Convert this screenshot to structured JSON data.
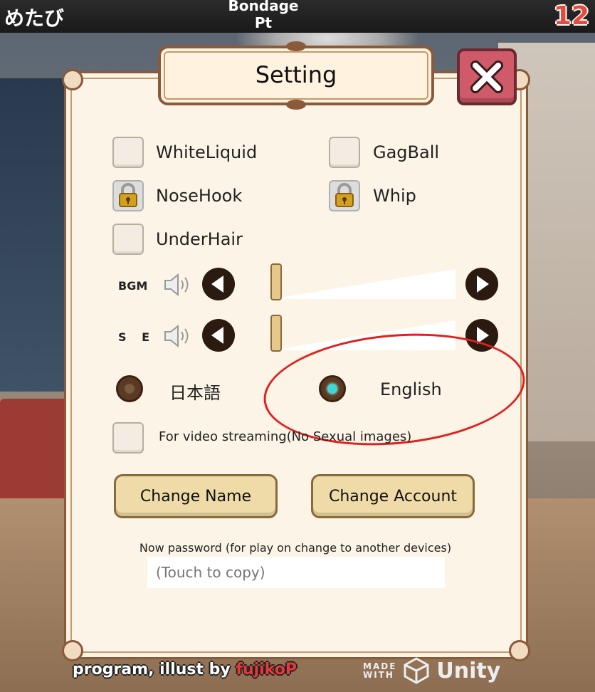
{
  "topbar": {
    "player_name": "めたび",
    "mode_line1": "Bondage",
    "mode_line2": "Pt",
    "count": "12"
  },
  "dialog": {
    "title": "Setting",
    "close_icon": "close-x-icon"
  },
  "toggles": [
    {
      "label": "WhiteLiquid",
      "state": "unchecked"
    },
    {
      "label": "GagBall",
      "state": "unchecked"
    },
    {
      "label": "NoseHook",
      "state": "locked"
    },
    {
      "label": "Whip",
      "state": "locked"
    },
    {
      "label": "UnderHair",
      "state": "unchecked"
    }
  ],
  "volume": {
    "bgm": {
      "label": "BGM",
      "level": 0.0
    },
    "se": {
      "label": "S E",
      "level": 0.0
    }
  },
  "language": {
    "japanese_label": "日本語",
    "english_label": "English",
    "selected": "English"
  },
  "streaming": {
    "label": "For video streaming(No Sexual images)",
    "state": "unchecked"
  },
  "buttons": {
    "change_name": "Change Name",
    "change_account": "Change Account"
  },
  "password": {
    "label": "Now password (for play on change to another devices)",
    "placeholder": "(Touch to copy)"
  },
  "footer": {
    "credit_prefix": "program, illust by ",
    "credit_name": "fujikoP",
    "made_with_1": "MADE",
    "made_with_2": "WITH",
    "engine": "Unity"
  },
  "colors": {
    "accent_red": "#e0201e",
    "panel_bg": "#fcf4e6",
    "border_brown": "#8a5a3a",
    "close_btn": "#cf5b6a",
    "radio_on": "#3fd6d6"
  }
}
